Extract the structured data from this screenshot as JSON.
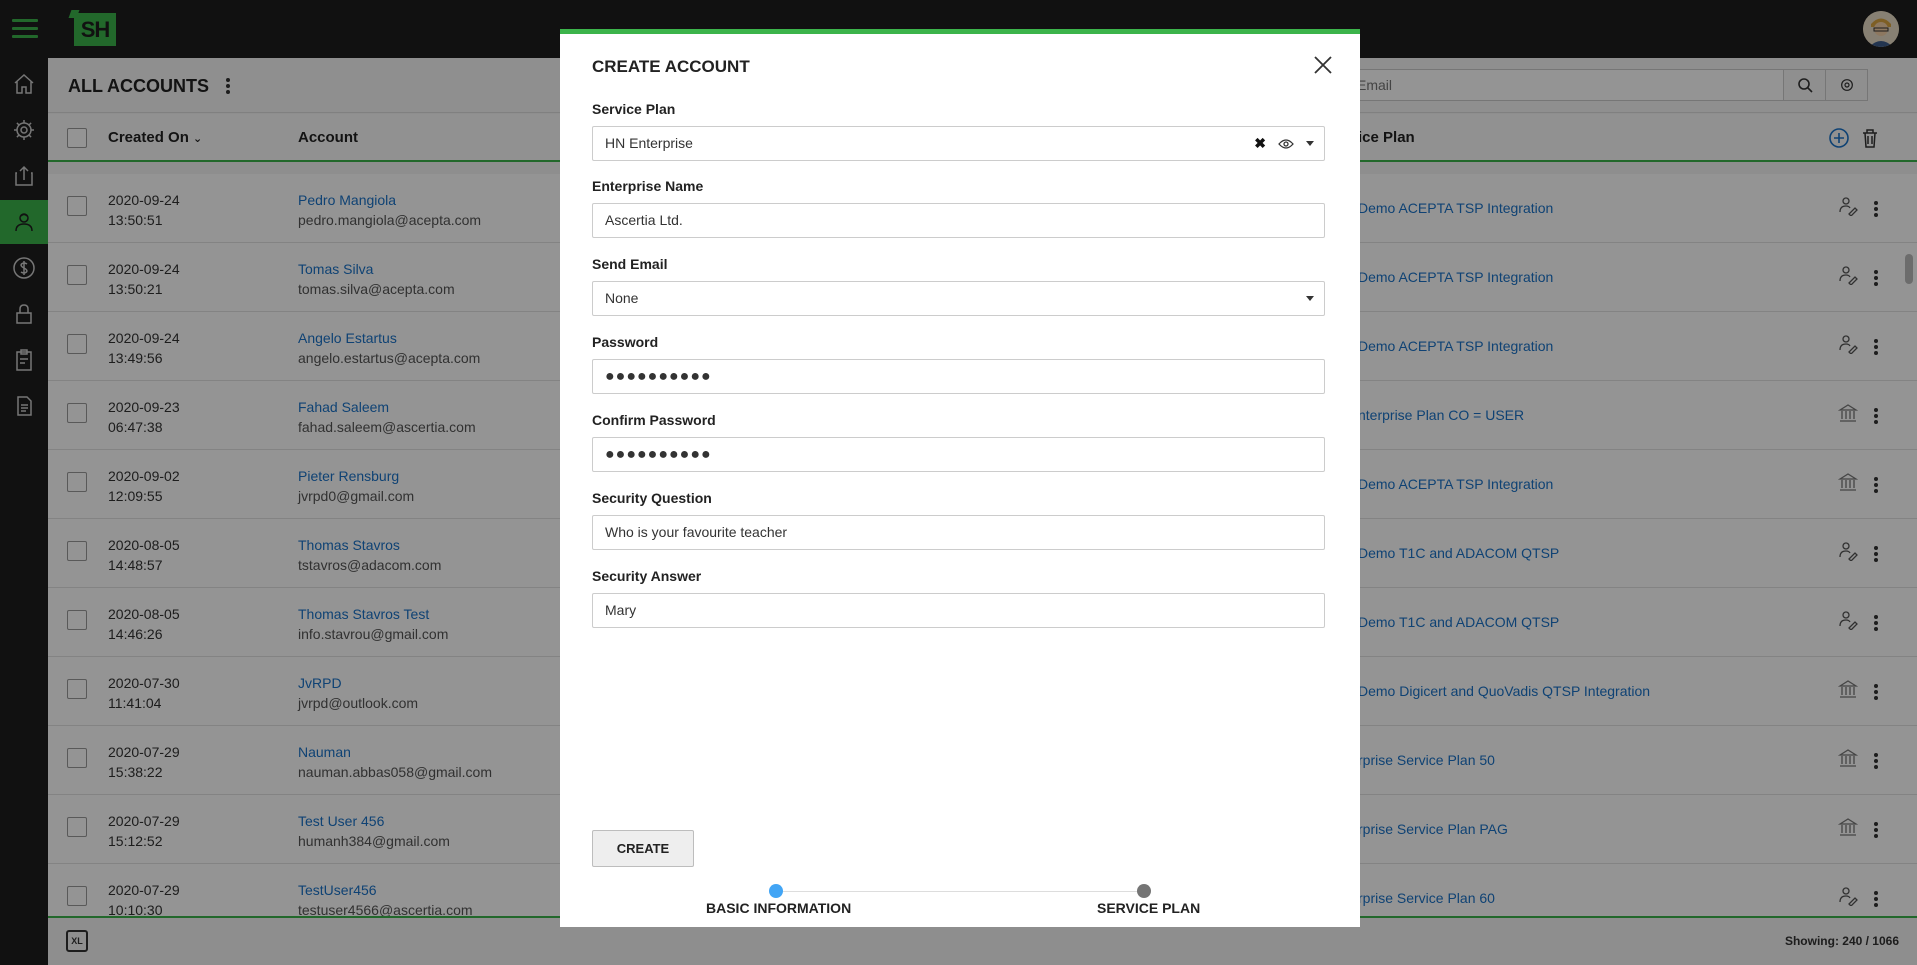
{
  "app": {
    "logo_text": "SH"
  },
  "sidebar": {
    "items": [
      {
        "icon": "home-icon"
      },
      {
        "icon": "gear-icon"
      },
      {
        "icon": "upload-icon"
      },
      {
        "icon": "user-icon",
        "active": true
      },
      {
        "icon": "dollar-icon"
      },
      {
        "icon": "lock-icon"
      },
      {
        "icon": "clipboard-icon"
      },
      {
        "icon": "report-icon"
      }
    ]
  },
  "header": {
    "title": "ALL ACCOUNTS",
    "search_placeholder": "Email"
  },
  "table": {
    "columns": {
      "created_on": "Created On",
      "account": "Account",
      "service_plan": "ice Plan"
    },
    "partial_top_email": "",
    "rows": [
      {
        "date": "2020-09-24",
        "time": "13:50:51",
        "name": "Pedro Mangiola",
        "email": "pedro.mangiola@acepta.com",
        "plan": "Demo ACEPTA TSP Integration",
        "icon": "signer-icon"
      },
      {
        "date": "2020-09-24",
        "time": "13:50:21",
        "name": "Tomas Silva",
        "email": "tomas.silva@acepta.com",
        "plan": "Demo ACEPTA TSP Integration",
        "icon": "signer-icon"
      },
      {
        "date": "2020-09-24",
        "time": "13:49:56",
        "name": "Angelo Estartus",
        "email": "angelo.estartus@acepta.com",
        "plan": "Demo ACEPTA TSP Integration",
        "icon": "signer-icon"
      },
      {
        "date": "2020-09-23",
        "time": "06:47:38",
        "name": "Fahad Saleem",
        "email": "fahad.saleem@ascertia.com",
        "plan": "nterprise Plan CO = USER",
        "icon": "bank-icon"
      },
      {
        "date": "2020-09-02",
        "time": "12:09:55",
        "name": "Pieter Rensburg",
        "email": "jvrpd0@gmail.com",
        "plan": "Demo ACEPTA TSP Integration",
        "icon": "bank-icon"
      },
      {
        "date": "2020-08-05",
        "time": "14:48:57",
        "name": "Thomas Stavros",
        "email": "tstavros@adacom.com",
        "plan": "Demo T1C and ADACOM QTSP",
        "icon": "signer-icon"
      },
      {
        "date": "2020-08-05",
        "time": "14:46:26",
        "name": "Thomas Stavros Test",
        "email": "info.stavrou@gmail.com",
        "plan": "Demo T1C and ADACOM QTSP",
        "icon": "signer-icon"
      },
      {
        "date": "2020-07-30",
        "time": "11:41:04",
        "name": "JvRPD",
        "email": "jvrpd@outlook.com",
        "plan": "Demo Digicert and QuoVadis QTSP Integration",
        "icon": "bank-icon"
      },
      {
        "date": "2020-07-29",
        "time": "15:38:22",
        "name": "Nauman",
        "email": "nauman.abbas058@gmail.com",
        "plan": "rprise Service Plan 50",
        "icon": "bank-icon"
      },
      {
        "date": "2020-07-29",
        "time": "15:12:52",
        "name": "Test User 456",
        "email": "humanh384@gmail.com",
        "plan": "rprise Service Plan PAG",
        "icon": "bank-icon"
      },
      {
        "date": "2020-07-29",
        "time": "10:10:30",
        "name": "TestUser456",
        "email": "testuser4566@ascertia.com",
        "plan": "rprise Service Plan 60",
        "icon": "signer-icon"
      }
    ]
  },
  "footer": {
    "export_label": "XL",
    "showing": "Showing: 240 / 1066"
  },
  "modal": {
    "title": "CREATE ACCOUNT",
    "service_plan": {
      "label": "Service Plan",
      "value": "HN Enterprise"
    },
    "enterprise_name": {
      "label": "Enterprise Name",
      "value": "Ascertia Ltd."
    },
    "send_email": {
      "label": "Send Email",
      "value": "None"
    },
    "password": {
      "label": "Password",
      "value": "●●●●●●●●●●"
    },
    "confirm_password": {
      "label": "Confirm Password",
      "value": "●●●●●●●●●●"
    },
    "security_question": {
      "label": "Security Question",
      "value": "Who is your favourite teacher"
    },
    "security_answer": {
      "label": "Security Answer",
      "value": "Mary"
    },
    "create_button": "CREATE",
    "steps": [
      {
        "label": "BASIC INFORMATION",
        "color": "#42a5f5"
      },
      {
        "label": "SERVICE PLAN",
        "color": "#757575"
      }
    ]
  },
  "colors": {
    "accent": "#3cb44b",
    "link": "#1a73c8"
  }
}
